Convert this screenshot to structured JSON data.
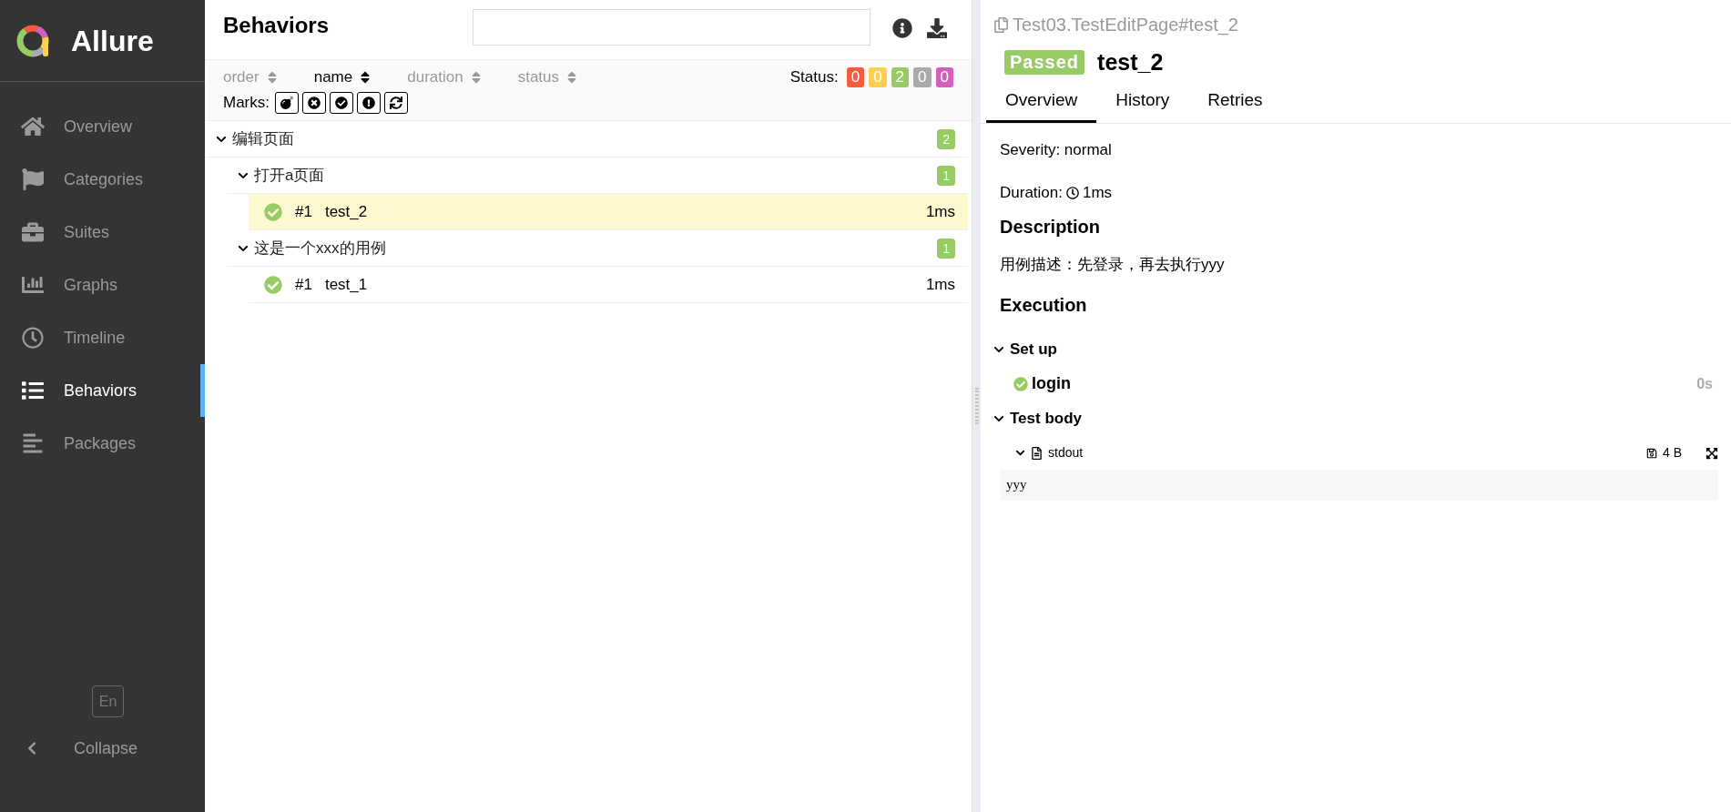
{
  "sidebar": {
    "brand": "Allure",
    "items": [
      {
        "label": "Overview",
        "selected": false
      },
      {
        "label": "Categories",
        "selected": false
      },
      {
        "label": "Suites",
        "selected": false
      },
      {
        "label": "Graphs",
        "selected": false
      },
      {
        "label": "Timeline",
        "selected": false
      },
      {
        "label": "Behaviors",
        "selected": true
      },
      {
        "label": "Packages",
        "selected": false
      }
    ],
    "language": "En",
    "collapse": "Collapse"
  },
  "behaviors": {
    "title": "Behaviors",
    "sorters": [
      {
        "label": "order",
        "selected": false
      },
      {
        "label": "name",
        "selected": true
      },
      {
        "label": "duration",
        "selected": false
      },
      {
        "label": "status",
        "selected": false
      }
    ],
    "status_label": "Status:",
    "status_counts": [
      {
        "count": "0",
        "color": "#fd5a3e"
      },
      {
        "count": "0",
        "color": "#ffd050"
      },
      {
        "count": "2",
        "color": "#97cc64"
      },
      {
        "count": "0",
        "color": "#aaaaaa"
      },
      {
        "count": "0",
        "color": "#d35ebe"
      }
    ],
    "marks_label": "Marks:",
    "tree": [
      {
        "kind": "group",
        "name": "编辑页面",
        "count": "2",
        "expanded": true,
        "children": [
          {
            "kind": "group",
            "name": "打开a页面",
            "count": "1",
            "expanded": true,
            "children": [
              {
                "kind": "test",
                "number": "#1",
                "name": "test_2",
                "duration": "1ms",
                "selected": true
              }
            ]
          },
          {
            "kind": "group",
            "name": "这是一个xxx的用例",
            "count": "1",
            "expanded": true,
            "children": [
              {
                "kind": "test",
                "number": "#1",
                "name": "test_1",
                "duration": "1ms",
                "selected": false
              }
            ]
          }
        ]
      }
    ]
  },
  "detail": {
    "path": "Test03.TestEditPage#test_2",
    "status": "Passed",
    "name": "test_2",
    "tabs": [
      {
        "label": "Overview",
        "selected": true
      },
      {
        "label": "History",
        "selected": false
      },
      {
        "label": "Retries",
        "selected": false
      }
    ],
    "severity": "Severity: normal",
    "duration_label": "Duration:",
    "duration": "1ms",
    "description_heading": "Description",
    "description": "用例描述：先登录，再去执行yyy",
    "execution_heading": "Execution",
    "stages": [
      {
        "title": "Set up",
        "expanded": true,
        "steps": [
          {
            "name": "login",
            "duration": "0s"
          }
        ]
      },
      {
        "title": "Test body",
        "expanded": true,
        "attachments": [
          {
            "name": "stdout",
            "size": "4 B",
            "expanded": true,
            "content": "yyy"
          }
        ]
      }
    ]
  }
}
